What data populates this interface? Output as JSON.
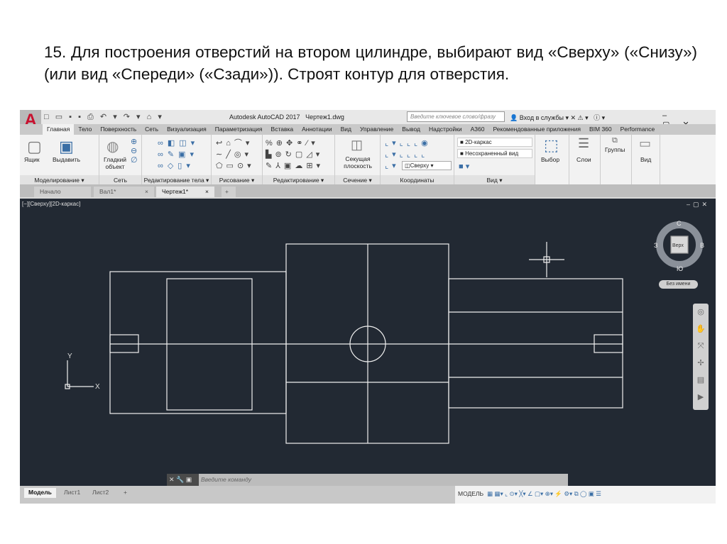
{
  "slide": {
    "title": "15. Для построения отверстий на втором цилиндре, выбирают вид «Сверху» («Снизу») (или вид «Спереди» («Сзади»)). Строят контур для отверстия."
  },
  "app": {
    "title": "Autodesk AutoCAD 2017",
    "file": "Чертеж1.dwg",
    "search_placeholder": "Введите ключевое слово/фразу",
    "signin": "Вход в службы"
  },
  "ribbon_tabs": [
    "Главная",
    "Тело",
    "Поверхность",
    "Сеть",
    "Визуализация",
    "Параметризация",
    "Вставка",
    "Аннотации",
    "Вид",
    "Управление",
    "Вывод",
    "Надстройки",
    "A360",
    "Рекомендованные приложения",
    "BIM 360",
    "Performance"
  ],
  "panels": {
    "modeling": "Моделирование ▾",
    "box": "Ящик",
    "extrude": "Выдавить",
    "mesh": "Сеть",
    "smooth": "Гладкий объект",
    "solid_edit": "Редактирование тела ▾",
    "draw": "Рисование ▾",
    "modify": "Редактирование ▾",
    "section": "Сечение ▾",
    "section_plane": "Секущая плоскость",
    "coords": "Координаты",
    "view_panel": "Вид ▾",
    "visual_style": "2D-каркас",
    "named_view": "Несохраненный вид",
    "view_dir": "Сверху",
    "select": "Выбор",
    "layers": "Слои",
    "groups": "Группы",
    "view": "Вид"
  },
  "doc_tabs": [
    "Начало",
    "Вал1*",
    "Чертеж1*"
  ],
  "viewport": {
    "label": "[−][Сверху][2D-каркас]",
    "viewcube": {
      "top": "Верх",
      "n": "С",
      "s": "Ю",
      "w": "З",
      "e": "В"
    },
    "named": "Без имени",
    "ucs_x": "X",
    "ucs_y": "Y"
  },
  "command": {
    "placeholder": "Введите команду"
  },
  "layout_tabs": [
    "Модель",
    "Лист1",
    "Лист2"
  ],
  "status": {
    "mode": "МОДЕЛЬ"
  }
}
